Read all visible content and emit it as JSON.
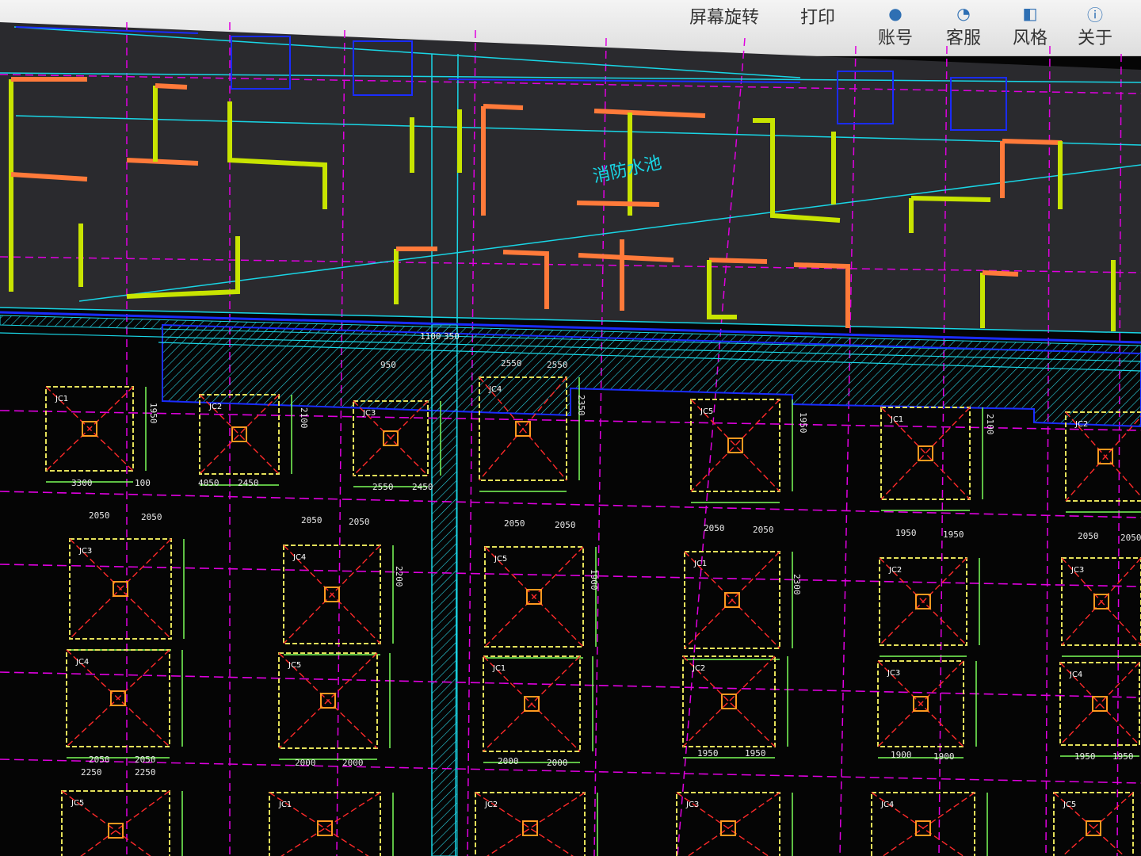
{
  "toolbar": {
    "items": [
      {
        "label": "屏幕旋转",
        "icon": "rotate-icon"
      },
      {
        "label": "打印",
        "icon": "printer-icon"
      },
      {
        "label": "账号",
        "icon": "user-icon"
      },
      {
        "label": "客服",
        "icon": "headset-icon"
      },
      {
        "label": "风格",
        "icon": "palette-icon"
      },
      {
        "label": "关于",
        "icon": "info-icon"
      }
    ]
  },
  "drawing": {
    "note": "消防水池",
    "dims_top": [
      "1100",
      "350",
      "2550",
      "2550",
      "950"
    ],
    "row1_dims": [
      "3300",
      "100",
      "4050",
      "2450",
      "2550",
      "2450"
    ],
    "row2_dims": [
      "2050",
      "2050",
      "2050",
      "2050",
      "2050",
      "2050",
      "2050",
      "2050",
      "1950",
      "1950",
      "2050",
      "2050"
    ],
    "row3_dims": [
      "2050",
      "2050",
      "2000",
      "2000",
      "2000",
      "2000",
      "1950",
      "1950",
      "1900",
      "1900",
      "1950",
      "1950"
    ],
    "row3b_dims": [
      "2250",
      "2250"
    ],
    "side_dims": [
      "1950",
      "2100",
      "2350",
      "1950",
      "2100",
      "2200",
      "1900",
      "2300"
    ],
    "labels": [
      "JC1",
      "JC2",
      "JC3",
      "JC4",
      "JC5"
    ]
  },
  "colors": {
    "background": "#050505",
    "upper_background": "#2a2a2e",
    "wall_yellow": "#c8e400",
    "wall_orange": "#ff7a3a",
    "grid_magenta": "#e000e0",
    "axis_cyan": "#19d6e6",
    "footing_yellow": "#e4e05a",
    "footing_red": "#ff2a2a",
    "dim_green": "#7cff5a",
    "blue_outline": "#1a2cff"
  }
}
